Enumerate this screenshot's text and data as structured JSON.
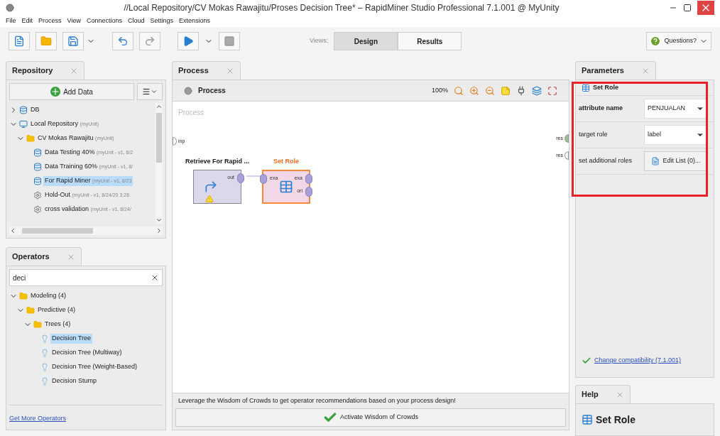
{
  "window": {
    "title": "//Local Repository/CV Mokas Rawajitu/Proses Decision Tree* – RapidMiner Studio Professional 7.1.001 @ MyUnity"
  },
  "menu": [
    "File",
    "Edit",
    "Process",
    "View",
    "Connections",
    "Cloud",
    "Settings",
    "Extensions"
  ],
  "toolbar": {
    "views_label": "Views:",
    "views": [
      {
        "label": "Design",
        "selected": true
      },
      {
        "label": "Results",
        "selected": false
      }
    ],
    "help": "Questions?"
  },
  "repository": {
    "tab": "Repository",
    "add_data": "Add Data",
    "items": [
      {
        "kind": "db",
        "label": "DB",
        "expanded": false
      },
      {
        "kind": "repo",
        "label": "Local Repository",
        "meta": "(myUnit)",
        "expanded": true,
        "children": [
          {
            "kind": "folder",
            "label": "CV Mokas Rawajitu",
            "meta": "(myUnit)",
            "expanded": true,
            "children": [
              {
                "kind": "data",
                "label": "Data Testing 40%",
                "meta": "(myUnit - v1, 8/2",
                "selected": false
              },
              {
                "kind": "data",
                "label": "Data Training 60%",
                "meta": "(myUnit - v1, 8/",
                "selected": false
              },
              {
                "kind": "data",
                "label": "For Rapid Miner",
                "meta": "(myUnit - v1, 8/23",
                "selected": true
              },
              {
                "kind": "process",
                "label": "Hold-Out",
                "meta": "(myUnit - v1, 8/24/20 3:28",
                "selected": false
              },
              {
                "kind": "process",
                "label": "cross validation",
                "meta": "(myUnit - v1, 8/24/",
                "selected": false
              }
            ]
          }
        ]
      }
    ]
  },
  "operators": {
    "tab": "Operators",
    "search": "deci",
    "items": [
      {
        "kind": "folder",
        "label": "Modeling (4)",
        "children": [
          {
            "kind": "folder",
            "label": "Predictive (4)",
            "children": [
              {
                "kind": "folder",
                "label": "Trees (4)",
                "children": [
                  {
                    "kind": "operator",
                    "label": "Decision Tree",
                    "selected": true
                  },
                  {
                    "kind": "operator",
                    "label": "Decision Tree (Multiway)",
                    "selected": false
                  },
                  {
                    "kind": "operator",
                    "label": "Decision Tree (Weight-Based)",
                    "selected": false
                  },
                  {
                    "kind": "operator",
                    "label": "Decision Stump",
                    "selected": false
                  }
                ]
              }
            ]
          }
        ]
      }
    ],
    "footer_link": "Get More Operators"
  },
  "process": {
    "tab": "Process",
    "header": "Process",
    "zoom": "100%",
    "canvas_label": "Process",
    "input_port": "inp",
    "output_ports": [
      "res",
      "res"
    ],
    "nodes": [
      {
        "kind": "retrieve",
        "label": "Retrieve For Rapid ...",
        "selected": false,
        "warning": true,
        "ports_out": [
          "out"
        ]
      },
      {
        "kind": "set_role",
        "label": "Set Role",
        "selected": true,
        "warning": false,
        "ports_in": [
          "exa"
        ],
        "ports_out": [
          "exa",
          "ori"
        ]
      }
    ],
    "hint": "Leverage the Wisdom of Crowds to get operator recommendations based on your process design!",
    "activate": "Activate Wisdom of Crowds"
  },
  "parameters": {
    "tab": "Parameters",
    "operator": "Set Role",
    "params": [
      {
        "kind": "select",
        "label": "attribute name",
        "value": "PENJUALAN"
      },
      {
        "kind": "select",
        "label": "target role",
        "value": "label"
      },
      {
        "kind": "button",
        "label": "set additional roles",
        "value": "Edit List (0)..."
      }
    ],
    "compatibility": "Change compatibility (7.1.001)"
  },
  "help": {
    "tab": "Help",
    "title": "Set Role"
  }
}
